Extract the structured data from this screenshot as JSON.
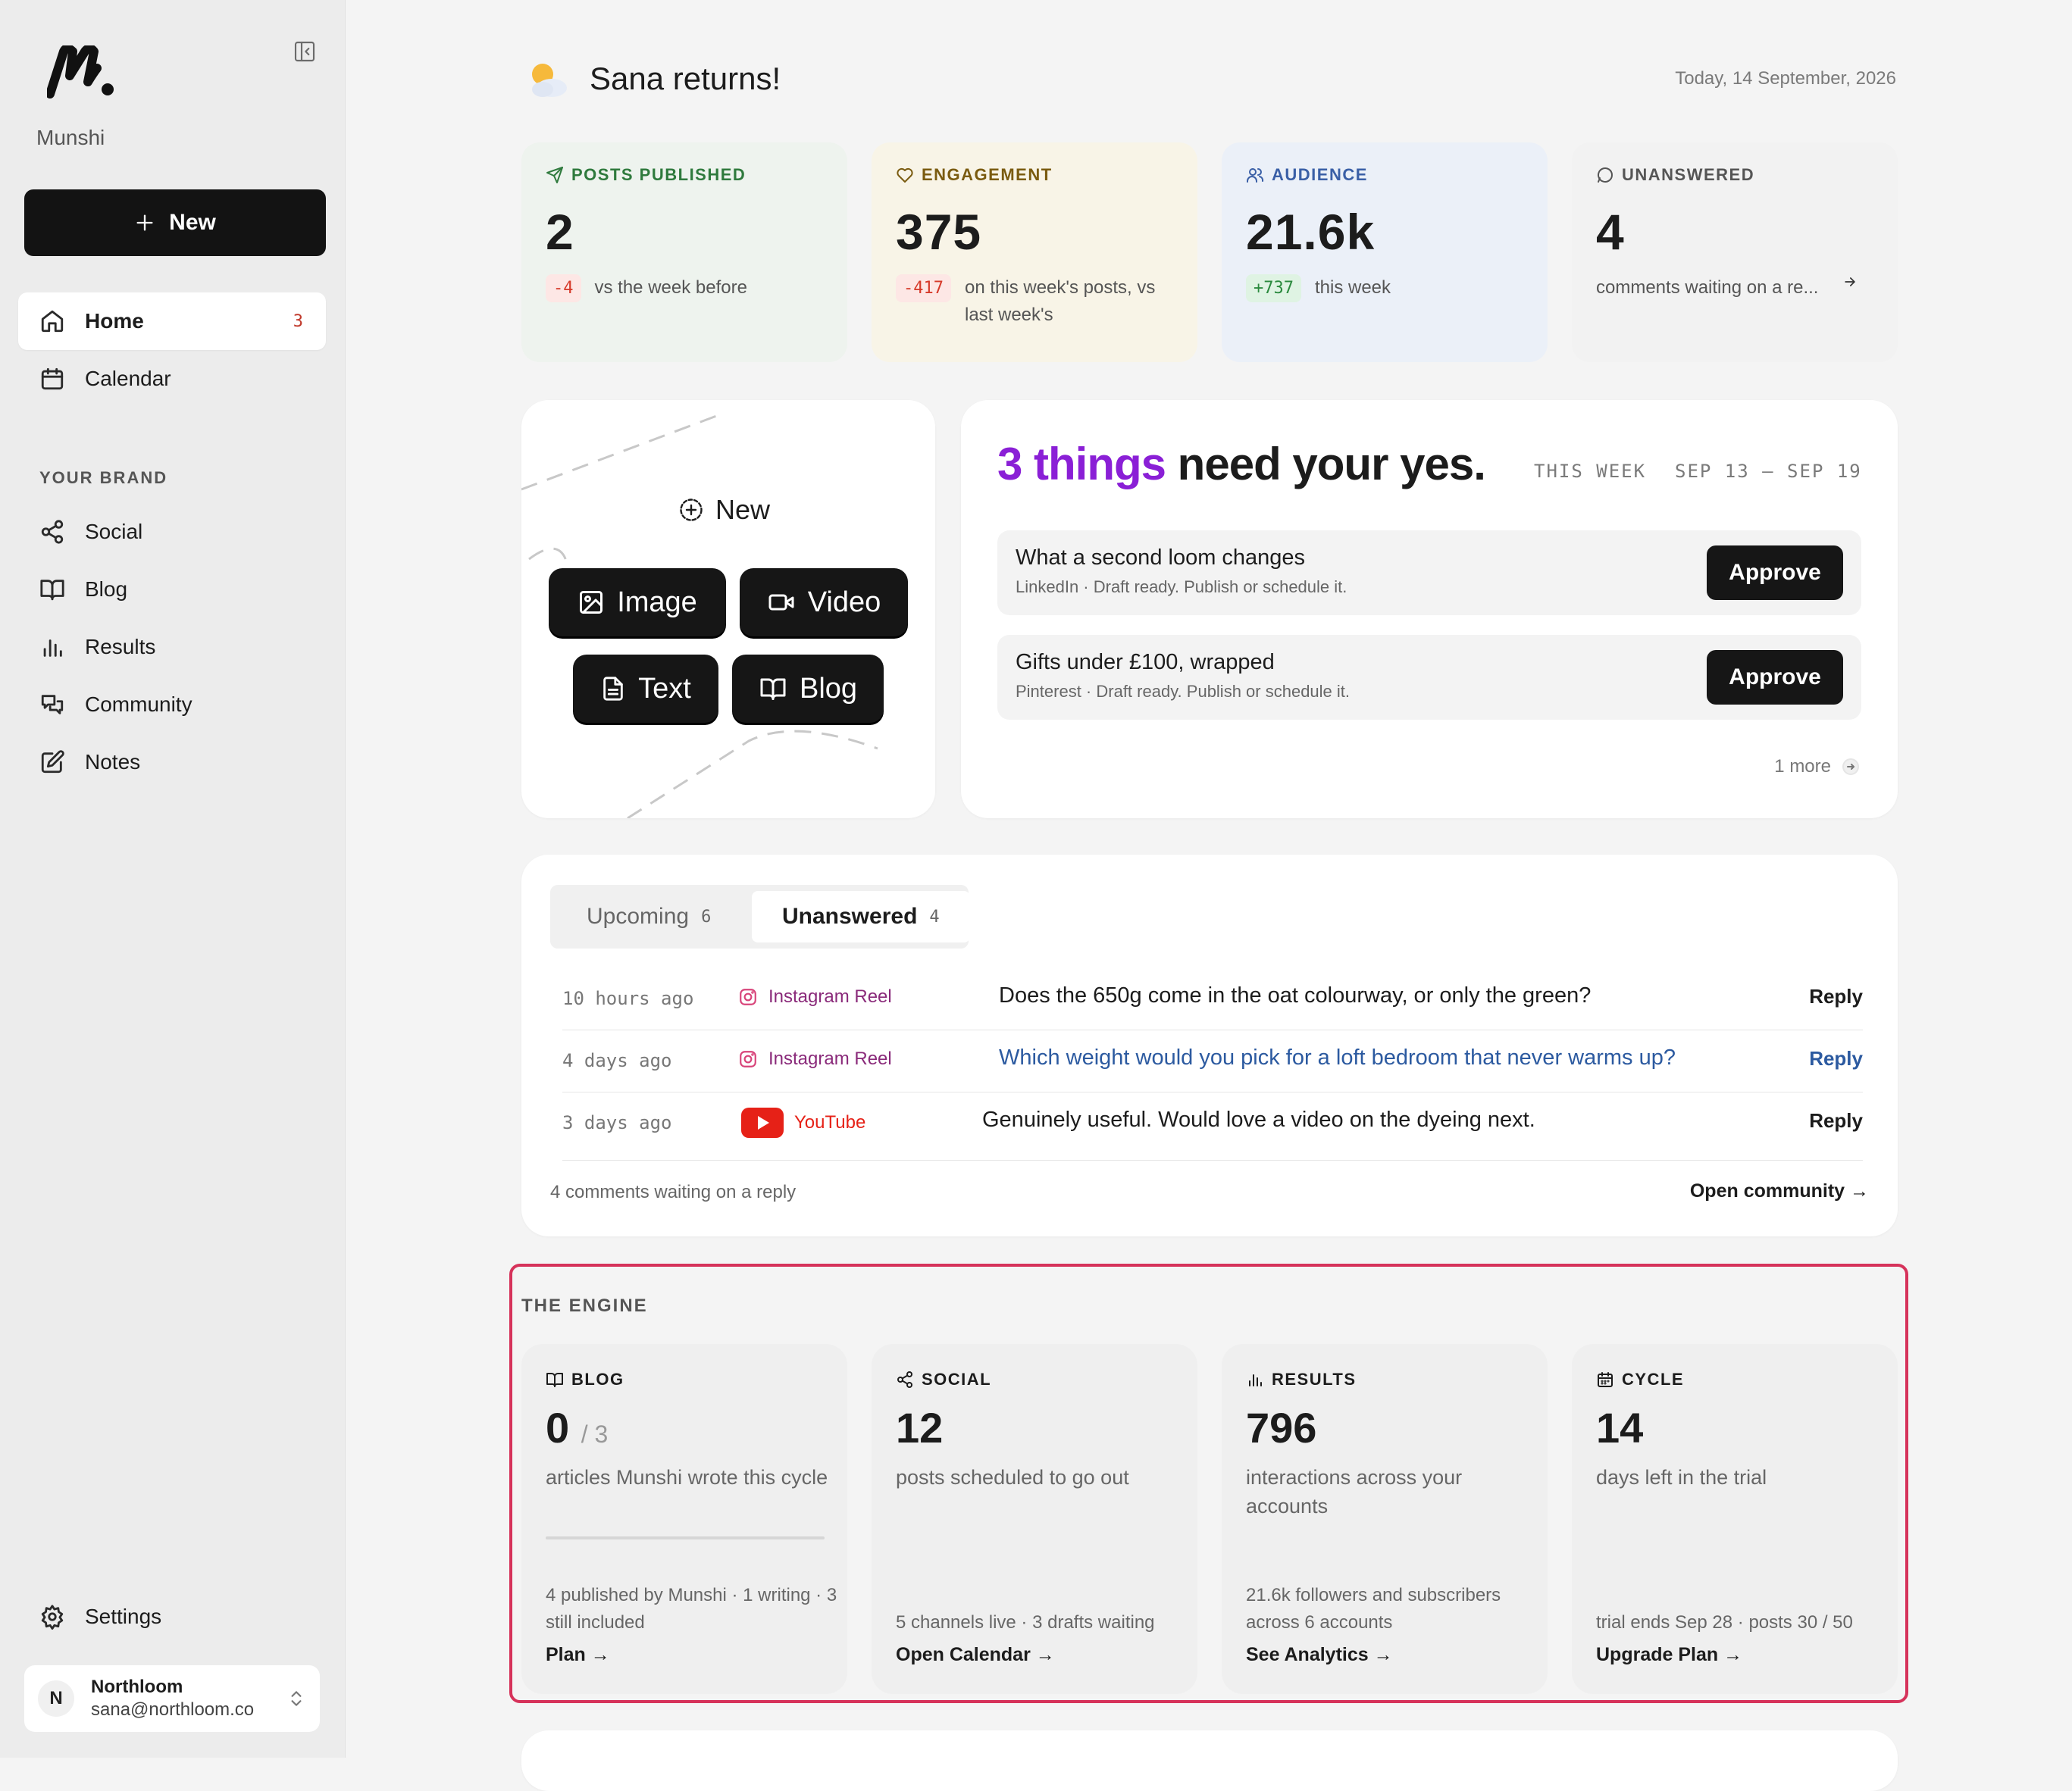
{
  "sidebar": {
    "brand": "Munshi",
    "new_label": "New",
    "nav": [
      {
        "label": "Home",
        "badge": "3"
      },
      {
        "label": "Calendar"
      }
    ],
    "section_label": "YOUR BRAND",
    "brand_nav": [
      {
        "label": "Social"
      },
      {
        "label": "Blog"
      },
      {
        "label": "Results"
      },
      {
        "label": "Community"
      },
      {
        "label": "Notes"
      }
    ],
    "settings_label": "Settings",
    "account": {
      "initial": "N",
      "name": "Northloom",
      "email": "sana@northloom.co"
    }
  },
  "header": {
    "greeting": "Sana returns!",
    "date": "Today, 14 September, 2026"
  },
  "stats": [
    {
      "label": "POSTS PUBLISHED",
      "value": "2",
      "delta": "-4",
      "note": "vs the week before",
      "color": "#2f7a3d",
      "bg": "#eef3ee"
    },
    {
      "label": "ENGAGEMENT",
      "value": "375",
      "delta": "-417",
      "note": "on this week's posts, vs last week's",
      "color": "#7a5b10",
      "bg": "#f8f4e7"
    },
    {
      "label": "AUDIENCE",
      "value": "21.6k",
      "delta": "+737",
      "note": "this week",
      "color": "#3a5fa6",
      "bg": "#ebf0f8"
    },
    {
      "label": "UNANSWERED",
      "value": "4",
      "note": "comments waiting on a re...",
      "color": "#555555",
      "bg": "#f2f2f2"
    }
  ],
  "create": {
    "new_label": "New",
    "buttons": {
      "image": "Image",
      "video": "Video",
      "text": "Text",
      "blog": "Blog"
    }
  },
  "approvals": {
    "title_highlight": "3 things",
    "title_rest": " need your yes.",
    "week_label": "THIS WEEK",
    "range": "SEP 13 – SEP 19",
    "items": [
      {
        "title": "What a second loom changes",
        "sub": "LinkedIn · Draft ready. Publish or schedule it.",
        "button": "Approve"
      },
      {
        "title": "Gifts under £100, wrapped",
        "sub": "Pinterest · Draft ready. Publish or schedule it.",
        "button": "Approve"
      }
    ],
    "more": "1 more"
  },
  "community": {
    "tabs": [
      {
        "label": "Upcoming",
        "count": "6"
      },
      {
        "label": "Unanswered",
        "count": "4"
      }
    ],
    "comments": [
      {
        "time": "10 hours ago",
        "platform": "Instagram Reel",
        "text": "Does the 650g come in the oat colourway, or only the green?",
        "reply": "Reply"
      },
      {
        "time": "4 days ago",
        "platform": "Instagram Reel",
        "text": "Which weight would you pick for a loft bedroom that never warms up?",
        "reply": "Reply"
      },
      {
        "time": "3 days ago",
        "platform": "YouTube",
        "text": "Genuinely useful. Would love a video on the dyeing next.",
        "reply": "Reply"
      }
    ],
    "footer": "4 comments waiting on a reply",
    "link": "Open community →"
  },
  "engine": {
    "label": "THE ENGINE",
    "cards": [
      {
        "label": "BLOG",
        "value": "0",
        "denominator": "/ 3",
        "progress": 0,
        "desc": "articles Munshi wrote this cycle",
        "meta": "4 published by Munshi · 1 writing · 3 still included",
        "link": "Plan →"
      },
      {
        "label": "SOCIAL",
        "value": "12",
        "desc": "posts scheduled to go out",
        "meta": "5 channels live · 3 drafts waiting",
        "link": "Open Calendar →"
      },
      {
        "label": "RESULTS",
        "value": "796",
        "desc": "interactions across your accounts",
        "meta": "21.6k followers and subscribers across 6 accounts",
        "link": "See Analytics →"
      },
      {
        "label": "CYCLE",
        "value": "14",
        "desc": "days left in the trial",
        "meta": "trial ends Sep 28 · posts 30 / 50",
        "link": "Upgrade Plan →"
      }
    ]
  },
  "colors": {
    "highlight": "#8a1fd6",
    "instagram": "#c13584",
    "youtube": "#e62117",
    "link_blue": "#2c5aa0",
    "engine_border": "#d6325a"
  }
}
